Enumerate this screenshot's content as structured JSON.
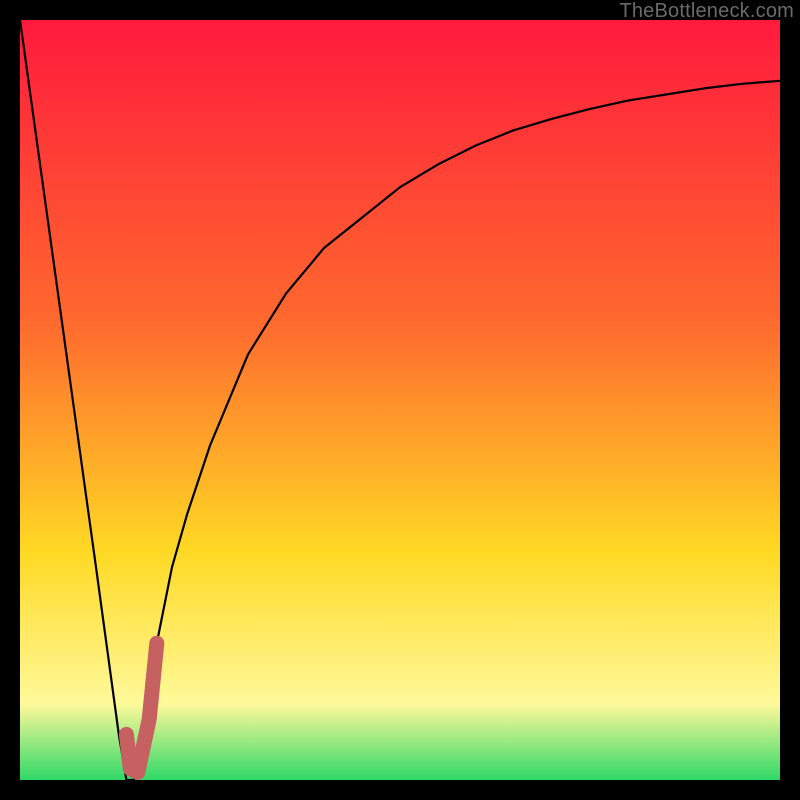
{
  "watermark": "TheBottleneck.com",
  "colors": {
    "gradient_top": "#ff1a3c",
    "gradient_mid1": "#ff6a2e",
    "gradient_mid2": "#ffd924",
    "gradient_mid3": "#fff99a",
    "gradient_bottom": "#2fd968",
    "frame_bg": "#000000",
    "curve": "#000000",
    "marker": "#c76060"
  },
  "chart_data": {
    "type": "line",
    "title": "",
    "xlabel": "",
    "ylabel": "",
    "xlim": [
      0,
      100
    ],
    "ylim": [
      0,
      100
    ],
    "series": [
      {
        "name": "bottleneck-curve",
        "x": [
          0,
          5,
          10,
          13,
          14,
          15,
          16,
          18,
          20,
          22,
          25,
          30,
          35,
          40,
          45,
          50,
          55,
          60,
          65,
          70,
          75,
          80,
          85,
          90,
          95,
          100
        ],
        "values": [
          100,
          64,
          28,
          6,
          0,
          0,
          6,
          18,
          28,
          35,
          44,
          56,
          64,
          70,
          74,
          78,
          81,
          83.5,
          85.5,
          87,
          88.3,
          89.4,
          90.2,
          91,
          91.6,
          92
        ]
      }
    ],
    "marker": {
      "name": "highlight-J",
      "x": [
        14,
        14.5,
        15.5,
        17,
        18
      ],
      "values": [
        6,
        1.5,
        1,
        8,
        18
      ]
    }
  }
}
